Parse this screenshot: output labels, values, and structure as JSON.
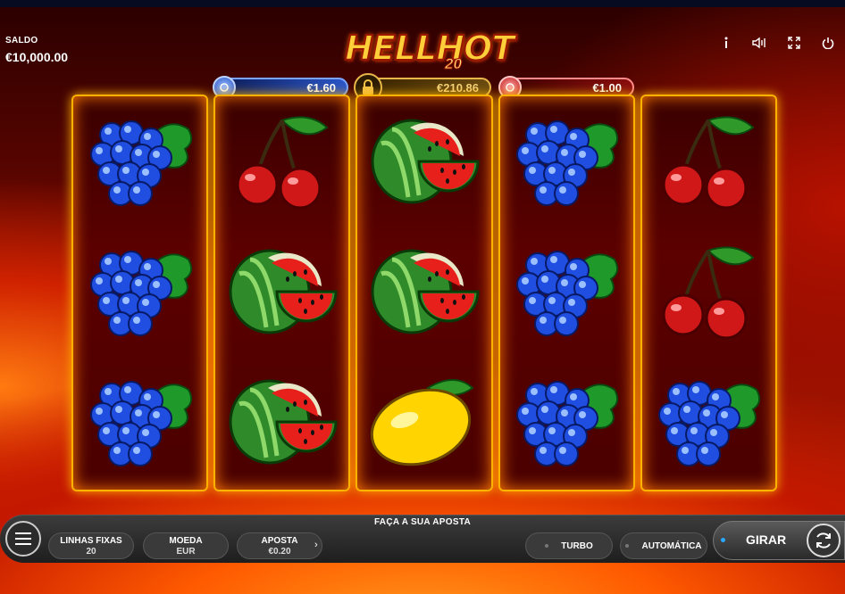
{
  "header": {
    "saldo_label": "SALDO",
    "saldo_value": "€10,000.00"
  },
  "logo": {
    "title": "HELLHOT",
    "number": "20"
  },
  "jackpots": [
    {
      "value": "€1.60",
      "color": "#2a55c8"
    },
    {
      "value": "€210.86",
      "color": "#e8b64a"
    },
    {
      "value": "€1.00",
      "color": "#d01818"
    }
  ],
  "top_icons": [
    "info-icon",
    "sound-icon",
    "fullscreen-icon",
    "power-icon"
  ],
  "reels": [
    [
      "grapes",
      "grapes",
      "grapes"
    ],
    [
      "cherry",
      "watermelon",
      "watermelon"
    ],
    [
      "watermelon",
      "watermelon",
      "lemon"
    ],
    [
      "grapes",
      "grapes",
      "grapes"
    ],
    [
      "cherry",
      "cherry",
      "grapes"
    ]
  ],
  "controls": {
    "prompt": "FAÇA A SUA APOSTA",
    "lines_label": "LINHAS FIXAS",
    "lines_value": "20",
    "coin_label": "MOEDA",
    "coin_value": "EUR",
    "bet_label": "APOSTA",
    "bet_value": "€0.20",
    "turbo": "TURBO",
    "auto": "AUTOMÁTICA",
    "spin": "GIRAR"
  }
}
